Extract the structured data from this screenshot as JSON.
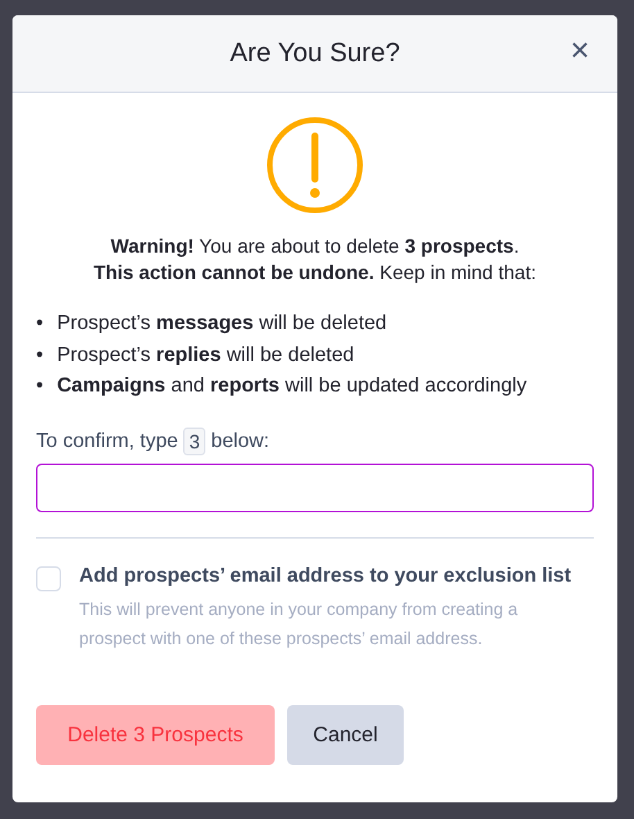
{
  "dialog": {
    "title": "Are You Sure?",
    "close": "×"
  },
  "warning": [
    "**Warning!** You are about to delete **3 prospects**.",
    "**This action cannot be undone.** Keep in mind that:"
  ],
  "bullets": [
    {
      "marker": "•",
      "text": "Prospect’s **messages** will be deleted"
    },
    {
      "marker": "•",
      "text": "Prospect’s **replies** will be deleted"
    },
    {
      "marker": "•",
      "text": "**Campaigns** and **reports** will be updated accordingly"
    }
  ],
  "confirm": {
    "prefix": "To confirm, type",
    "code": "3",
    "suffix": "below:"
  },
  "exclusion": {
    "label": "Add prospects’ email address to your exclusion list",
    "help": "This will prevent anyone in your company from creating a prospect with one of these prospects’ email address.",
    "checked": false
  },
  "buttons": [
    {
      "label": "Delete 3 Prospects",
      "kind": "danger",
      "disabled": true
    },
    {
      "label": "Cancel",
      "kind": "secondary"
    }
  ]
}
